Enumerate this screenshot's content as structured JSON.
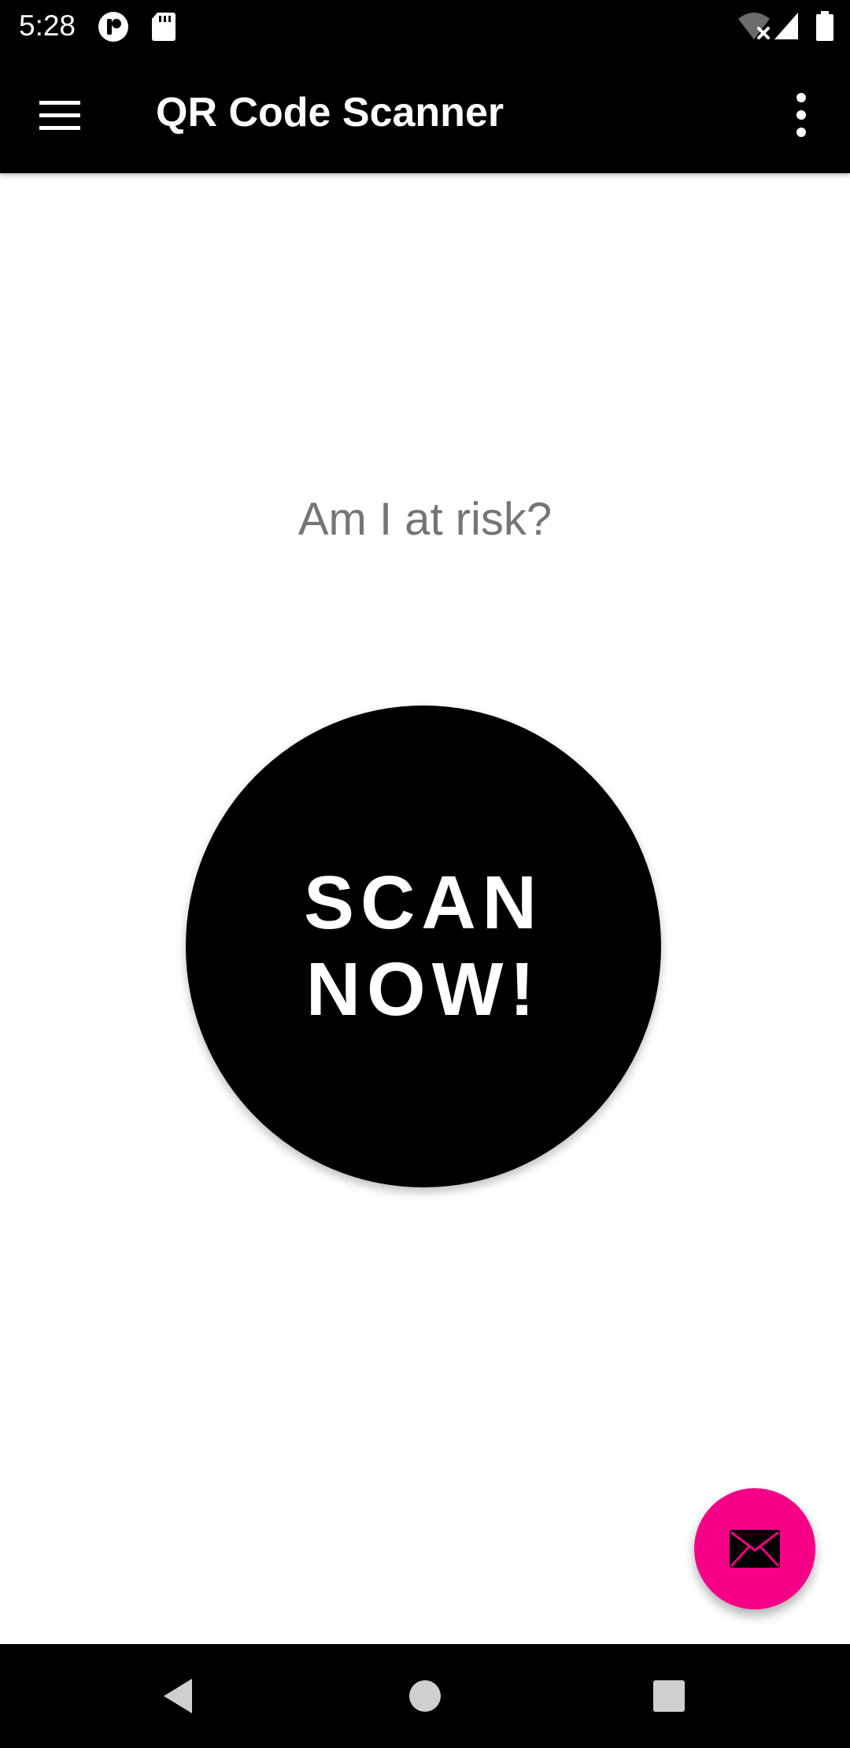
{
  "status_bar": {
    "time": "5:28",
    "icons": [
      "launcher-app-icon",
      "sd-card-icon",
      "wifi-off-icon",
      "signal-icon",
      "battery-icon"
    ]
  },
  "app_bar": {
    "title": "QR Code Scanner",
    "menu_icon": "hamburger-menu-icon",
    "overflow_icon": "more-vert-icon"
  },
  "main": {
    "question": "Am I at risk?",
    "scan_button_label": "SCAN NOW!"
  },
  "fab": {
    "icon": "mail-icon",
    "color": "#f50087"
  },
  "nav_bar": {
    "icons": [
      "back-icon",
      "home-icon",
      "recents-icon"
    ]
  },
  "colors": {
    "app_bar": "#000000",
    "question_text": "#757575",
    "scan_button": "#000000",
    "accent": "#f50087"
  }
}
